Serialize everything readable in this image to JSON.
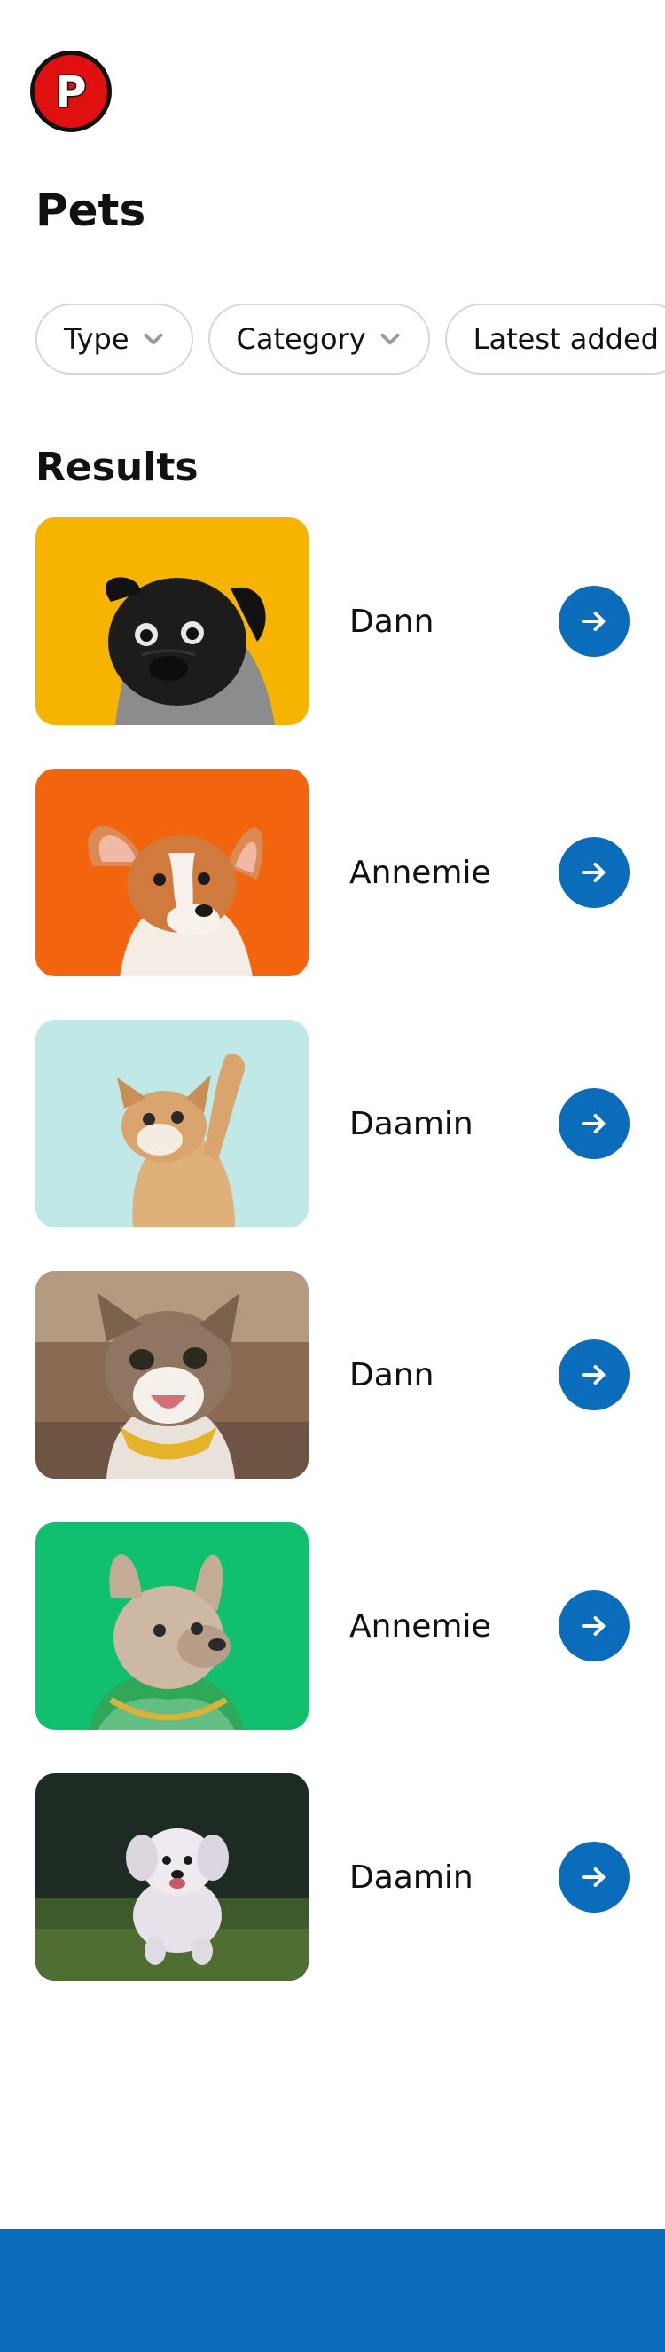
{
  "app": {
    "logo_letter": "P"
  },
  "page": {
    "title": "Pets"
  },
  "filters": [
    {
      "label": "Type",
      "has_dropdown": true
    },
    {
      "label": "Category",
      "has_dropdown": true
    },
    {
      "label": "Latest added",
      "has_dropdown": false
    }
  ],
  "results": {
    "title": "Results",
    "items": [
      {
        "name": "Dann",
        "photo": "black-pug-on-yellow",
        "background": "#f6b400"
      },
      {
        "name": "Annemie",
        "photo": "corgi-puppy-on-orange",
        "background": "#f2640e"
      },
      {
        "name": "Daamin",
        "photo": "kitten-on-mint",
        "background": "#bfe8e7"
      },
      {
        "name": "Dann",
        "photo": "tabby-cat-with-bandana",
        "background": "#8a6a52"
      },
      {
        "name": "Annemie",
        "photo": "french-bulldog-on-green",
        "background": "#11c06f"
      },
      {
        "name": "Daamin",
        "photo": "white-puppy-on-grass",
        "background": "#1e2b22"
      }
    ]
  },
  "colors": {
    "brand_red": "#e01010",
    "accent_blue": "#0a6cba",
    "chip_border": "#d6d6d6"
  },
  "icons": {
    "chevron": "chevron-down-icon",
    "arrow": "arrow-right-icon"
  }
}
